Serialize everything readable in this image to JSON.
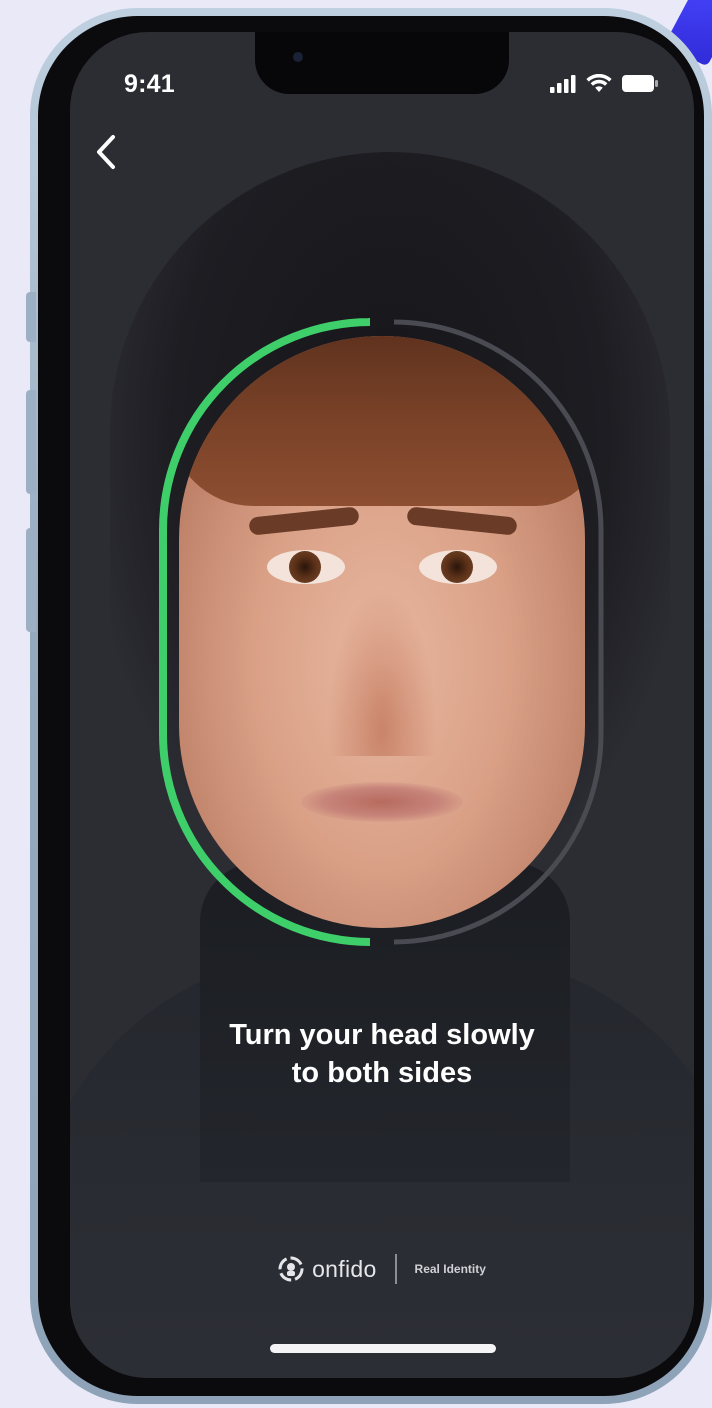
{
  "status_bar": {
    "time": "9:41",
    "icons": [
      "cellular-signal-icon",
      "wifi-icon",
      "battery-icon"
    ]
  },
  "navigation": {
    "back_icon": "chevron-left-icon"
  },
  "capture": {
    "progress": 0.5,
    "progress_color": "#3ecf6b",
    "track_color": "#4a4a52"
  },
  "instruction": {
    "line1": "Turn your head slowly",
    "line2": "to both sides"
  },
  "branding": {
    "name": "onfido",
    "tagline": "Real Identity",
    "logo_icon": "onfido-logo-icon"
  },
  "colors": {
    "accent": "#3ecf6b",
    "screen_background": "#2c2c33",
    "page_background": "#e9e9f8"
  }
}
